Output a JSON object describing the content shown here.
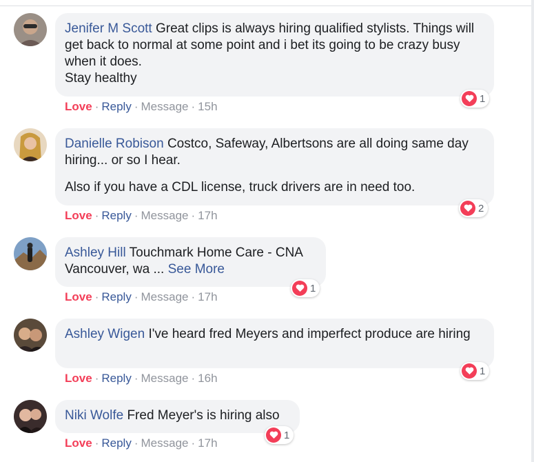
{
  "comments": [
    {
      "author": "Jenifer M Scott",
      "paragraphs": [
        "Great clips is always hiring qualified stylists. Things will get back to normal at some point and i bet its going to be crazy busy when it does.",
        "Stay healthy"
      ],
      "reaction_count": "1",
      "actions": {
        "love": "Love",
        "reply": "Reply",
        "message": "Message",
        "time": "15h"
      }
    },
    {
      "author": "Danielle Robison",
      "paragraphs": [
        "Costco, Safeway, Albertsons are all doing same day hiring... or so I hear.",
        "Also if you have a CDL license, truck drivers are in need too."
      ],
      "reaction_count": "2",
      "actions": {
        "love": "Love",
        "reply": "Reply",
        "message": "Message",
        "time": "17h"
      }
    },
    {
      "author": "Ashley Hill",
      "paragraphs": [
        "Touchmark Home Care - CNA Vancouver, wa ..."
      ],
      "see_more": "See More",
      "reaction_count": "1",
      "actions": {
        "love": "Love",
        "reply": "Reply",
        "message": "Message",
        "time": "17h"
      }
    },
    {
      "author": "Ashley Wigen",
      "paragraphs": [
        "I've heard fred Meyers and imperfect produce are hiring"
      ],
      "reaction_count": "1",
      "actions": {
        "love": "Love",
        "reply": "Reply",
        "message": "Message",
        "time": "16h"
      }
    },
    {
      "author": "Niki Wolfe",
      "paragraphs": [
        "Fred Meyer's is hiring also"
      ],
      "reaction_count": "1",
      "actions": {
        "love": "Love",
        "reply": "Reply",
        "message": "Message",
        "time": "17h"
      }
    }
  ],
  "separator": "·",
  "colors": {
    "link": "#385898",
    "love": "#f33e58",
    "muted": "#90949c",
    "bubble": "#f2f3f5"
  },
  "icons": {
    "reaction": "heart-icon"
  }
}
